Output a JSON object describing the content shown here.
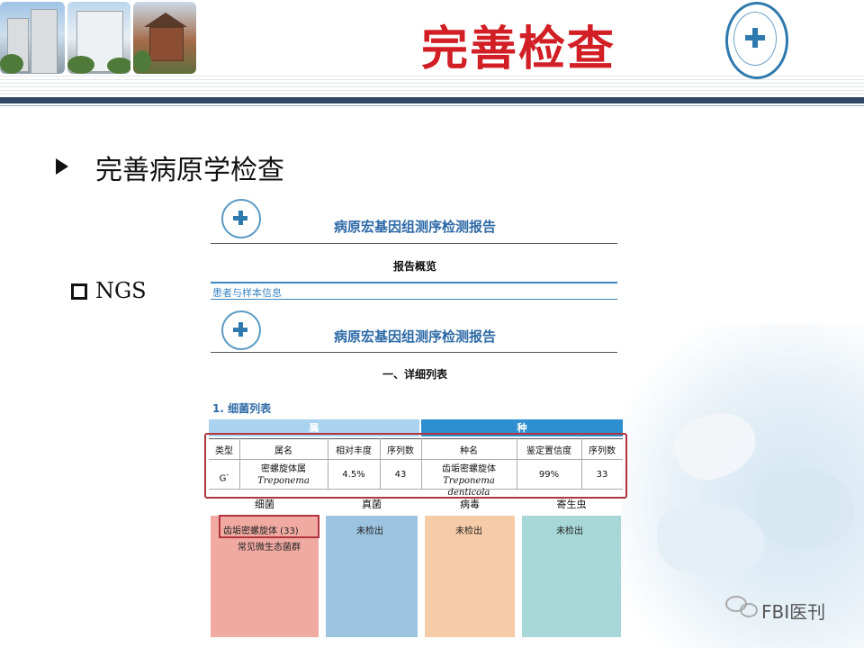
{
  "header": {
    "title": "完善检查",
    "title_color": "#d11f25",
    "rule_color": "#2f4766",
    "photos": [
      "hospital-building-photo",
      "hospital-tower-photo",
      "traditional-pavilion-photo"
    ],
    "seal": "hospital-seal-icon"
  },
  "main": {
    "bullet_text": "完善病原学检查",
    "ngs_label": "NGS"
  },
  "report": {
    "title_1": "病原宏基因组测序检测报告",
    "overview": "报告概览",
    "patient_info": "患者与样本信息",
    "title_2": "病原宏基因组测序检测报告",
    "section": "一、详细列表",
    "subsection": "1. 细菌列表",
    "genus_header": "属",
    "species_header": "种",
    "columns": [
      "类型",
      "属名",
      "相对丰度",
      "序列数",
      "种名",
      "鉴定置信度",
      "序列数"
    ],
    "row": {
      "type": "G",
      "type_sup": "-",
      "genus_cn": "密螺旋体属",
      "genus_latin": "Treponema",
      "abundance": "4.5%",
      "genus_reads": "43",
      "species_cn": "齿垢密螺旋体",
      "species_latin": "Treponema denticola",
      "confidence": "99%",
      "species_reads": "33"
    },
    "categories": [
      {
        "label": "细菌",
        "line1": "齿垢密螺旋体 (33)",
        "line2": "常见微生态菌群",
        "color": "#f0aaa2"
      },
      {
        "label": "真菌",
        "line1": "未检出",
        "line2": "",
        "color": "#9cc3e0"
      },
      {
        "label": "病毒",
        "line1": "未检出",
        "line2": "",
        "color": "#f6cba8"
      },
      {
        "label": "寄生虫",
        "line1": "未检出",
        "line2": "",
        "color": "#a7d7d6"
      }
    ],
    "genus_header_color": "#a9d3ee",
    "species_header_color": "#2e8fd0",
    "highlight_color": "#b2343d"
  },
  "watermark": {
    "text": "FBI医刊"
  }
}
